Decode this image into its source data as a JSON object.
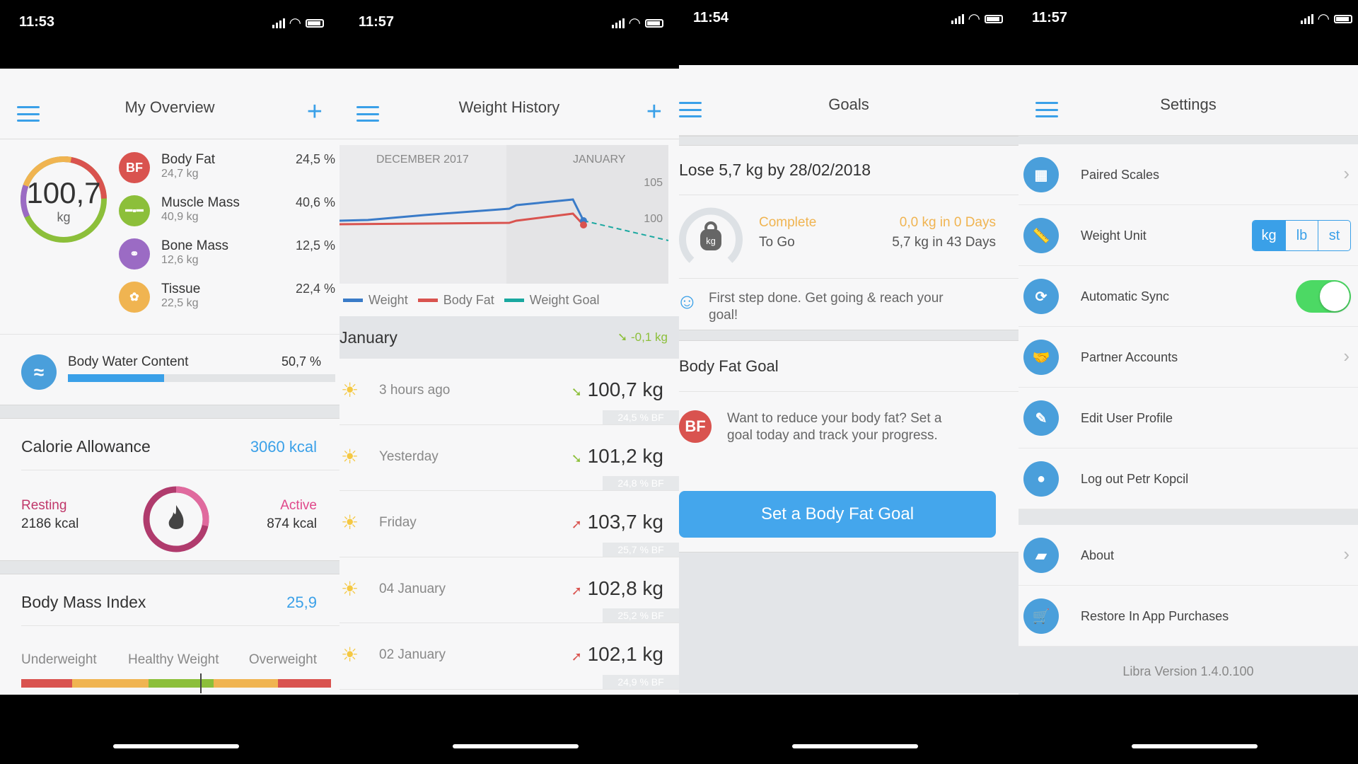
{
  "screens": [
    {
      "time": "11:53",
      "title": "My Overview"
    },
    {
      "time": "11:57",
      "title": "Weight History"
    },
    {
      "time": "11:54",
      "title": "Goals"
    },
    {
      "time": "11:57",
      "title": "Settings"
    }
  ],
  "overview": {
    "weight_value": "100,7",
    "weight_unit": "kg",
    "composition": [
      {
        "name": "Body Fat",
        "kg": "24,7 kg",
        "pct": "24,5 %",
        "icon": "BF",
        "color": "#d9534f"
      },
      {
        "name": "Muscle Mass",
        "kg": "40,9 kg",
        "pct": "40,6 %",
        "icon": "dumbbell",
        "color": "#8cbf3a"
      },
      {
        "name": "Bone Mass",
        "kg": "12,6 kg",
        "pct": "12,5 %",
        "icon": "bone",
        "color": "#9b6bc4"
      },
      {
        "name": "Tissue",
        "kg": "22,5 kg",
        "pct": "22,4 %",
        "icon": "tissue",
        "color": "#f0b451"
      }
    ],
    "water": {
      "label": "Body Water Content",
      "pct": "50,7 %",
      "fill": 0.507
    },
    "calorie": {
      "title": "Calorie Allowance",
      "total": "3060 kcal",
      "resting_label": "Resting",
      "resting": "2186 kcal",
      "active_label": "Active",
      "active": "874 kcal"
    },
    "bmi": {
      "title": "Body Mass Index",
      "value": "25,9",
      "labels": [
        "Underweight",
        "Healthy Weight",
        "Overweight"
      ]
    }
  },
  "history": {
    "chart_labels": {
      "left": "DECEMBER 2017",
      "right": "JANUARY",
      "y1": "105",
      "y2": "100"
    },
    "legend": [
      {
        "name": "Weight",
        "color": "#3a7bc8"
      },
      {
        "name": "Body Fat",
        "color": "#d9534f"
      },
      {
        "name": "Weight Goal",
        "color": "#1aa8a0"
      }
    ],
    "month": "January",
    "month_delta": "-0,1 kg",
    "entries": [
      {
        "when": "3 hours ago",
        "weight": "100,7 kg",
        "bf": "24,5 % BF",
        "dir": "down"
      },
      {
        "when": "Yesterday",
        "weight": "101,2 kg",
        "bf": "24,8 % BF",
        "dir": "down"
      },
      {
        "when": "Friday",
        "weight": "103,7 kg",
        "bf": "25,7 % BF",
        "dir": "up"
      },
      {
        "when": "04 January",
        "weight": "102,8 kg",
        "bf": "25,2 % BF",
        "dir": "up"
      },
      {
        "when": "02 January",
        "weight": "102,1 kg",
        "bf": "24,9 % BF",
        "dir": "up"
      }
    ]
  },
  "goals": {
    "headline": "Lose 5,7 kg by 28/02/2018",
    "complete_label": "Complete",
    "complete_value": "0,0 kg in 0 Days",
    "togo_label": "To Go",
    "togo_value": "5,7 kg in 43 Days",
    "tip": "First step done. Get going & reach your goal!",
    "bf_title": "Body Fat Goal",
    "bf_text": "Want to reduce your body fat? Set a goal today and track your progress.",
    "button": "Set a Body Fat Goal"
  },
  "settings": {
    "items": [
      {
        "label": "Paired Scales",
        "chevron": true
      },
      {
        "label": "Weight Unit"
      },
      {
        "label": "Automatic Sync"
      },
      {
        "label": "Partner Accounts",
        "chevron": true
      },
      {
        "label": "Edit User Profile"
      },
      {
        "label": "Log out Petr Kopcil"
      }
    ],
    "units": [
      "kg",
      "lb",
      "st"
    ],
    "items2": [
      {
        "label": "About",
        "chevron": true
      },
      {
        "label": "Restore In App Purchases"
      }
    ],
    "version": "Libra Version 1.4.0.100",
    "sync_on": true
  }
}
